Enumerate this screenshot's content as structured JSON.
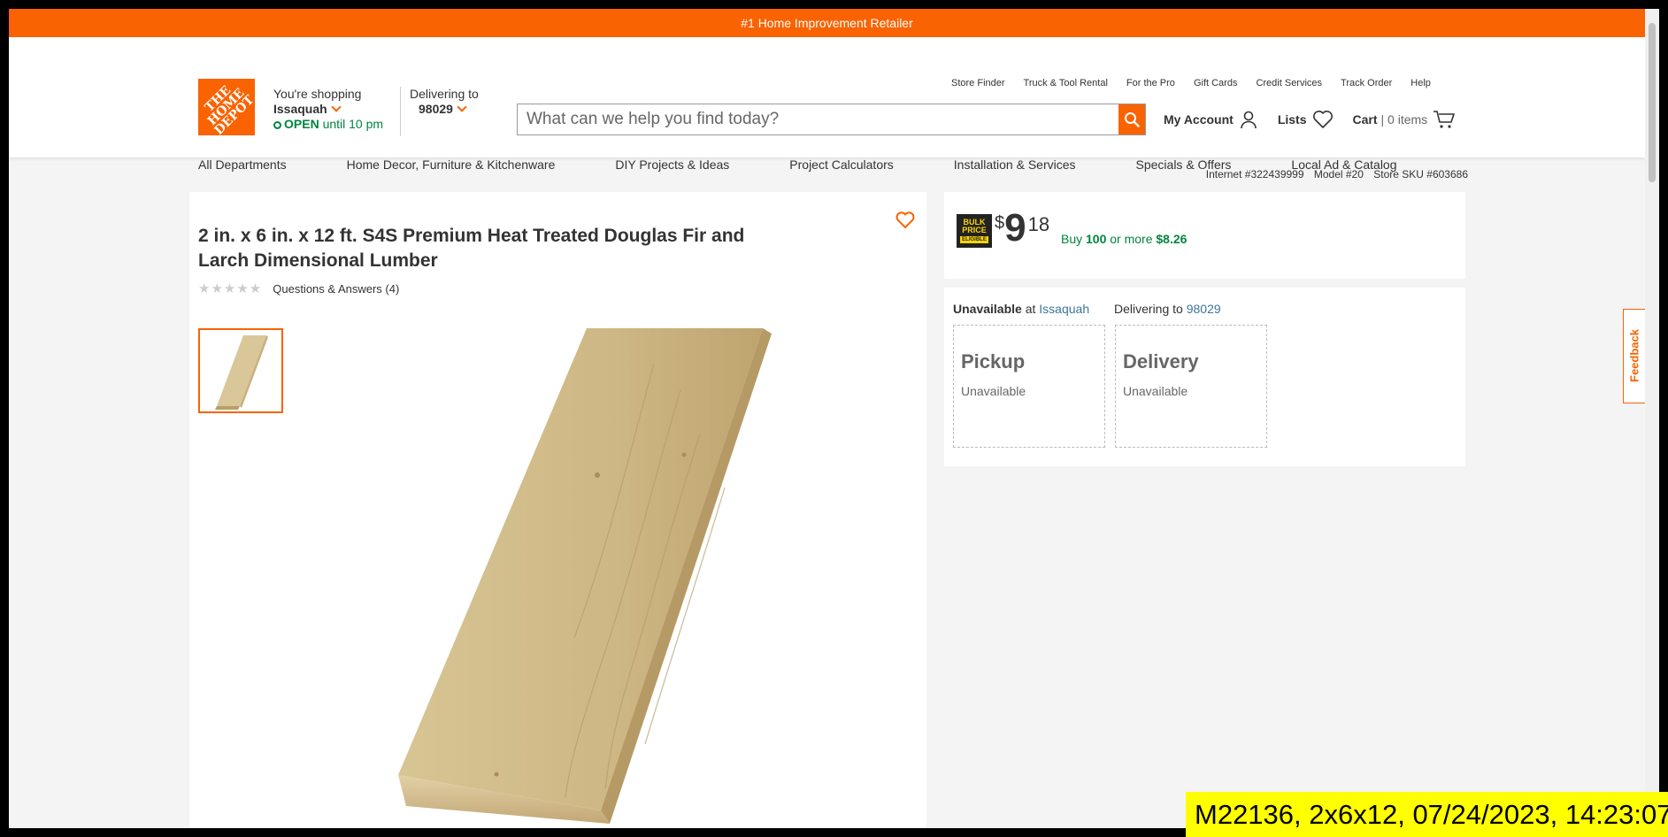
{
  "promo": {
    "text": "#1 Home Improvement Retailer"
  },
  "logo": {
    "text": "THE HOME DEPOT"
  },
  "store": {
    "label": "You're shopping",
    "name": "Issaquah",
    "status": "OPEN",
    "hours": "until 10 pm"
  },
  "delivery": {
    "label": "Delivering to",
    "zip": "98029"
  },
  "search": {
    "placeholder": "What can we help you find today?"
  },
  "util_nav": [
    "Store Finder",
    "Truck & Tool Rental",
    "For the Pro",
    "Gift Cards",
    "Credit Services",
    "Track Order",
    "Help"
  ],
  "account": {
    "my_account": "My Account",
    "lists": "Lists",
    "cart": "Cart",
    "cart_count": "| 0 items"
  },
  "main_nav": [
    "All Departments",
    "Home Decor, Furniture & Kitchenware",
    "DIY Projects & Ideas",
    "Project Calculators",
    "Installation & Services",
    "Specials & Offers",
    "Local Ad & Catalog"
  ],
  "sku": {
    "internet": "Internet #322439999",
    "model": "Model #20",
    "store_sku": "Store SKU #603686"
  },
  "product": {
    "title": "2 in. x 6 in. x 12 ft. S4S Premium Heat Treated Douglas Fir and Larch Dimensional Lumber",
    "stars": "★★★★★",
    "rating_value": 0,
    "qa": "Questions & Answers (4)"
  },
  "price": {
    "badge_line1": "BULK",
    "badge_line2": "PRICE",
    "badge_line3": "ELIGIBLE",
    "currency": "$",
    "dollars": "9",
    "cents": "18",
    "bulk_prefix": "Buy",
    "bulk_qty": "100",
    "bulk_mid": "or more",
    "bulk_price": "$8.26"
  },
  "fulfillment": {
    "unavailable": "Unavailable",
    "at": "at",
    "store": "Issaquah",
    "delivering_to": "Delivering to",
    "zip": "98029",
    "pickup_title": "Pickup",
    "pickup_status": "Unavailable",
    "delivery_title": "Delivery",
    "delivery_status": "Unavailable"
  },
  "feedback": {
    "label": "Feedback"
  },
  "stamp": {
    "text": "M22136, 2x6x12, 07/24/2023, 14:23:07"
  },
  "colors": {
    "brand": "#f96302",
    "open_green": "#00853e",
    "link": "#3e7697",
    "stamp_bg": "#ffff00"
  }
}
